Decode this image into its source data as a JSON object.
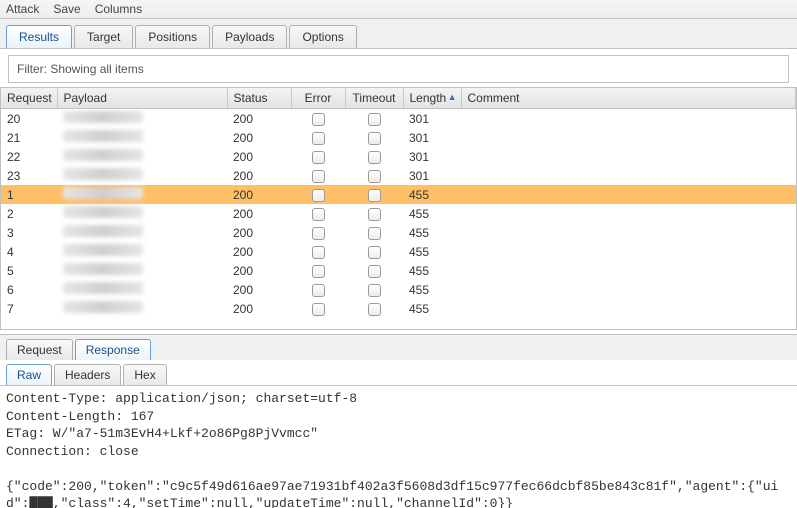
{
  "menu": {
    "attack": "Attack",
    "save": "Save",
    "columns": "Columns"
  },
  "tabs": {
    "results": "Results",
    "target": "Target",
    "positions": "Positions",
    "payloads": "Payloads",
    "options": "Options"
  },
  "filter": {
    "label": "Filter: Showing all items"
  },
  "columns": {
    "request": "Request",
    "payload": "Payload",
    "status": "Status",
    "error": "Error",
    "timeout": "Timeout",
    "length": "Length",
    "comment": "Comment"
  },
  "rows": [
    {
      "request": "20",
      "status": "200",
      "length": "301",
      "selected": false
    },
    {
      "request": "21",
      "status": "200",
      "length": "301",
      "selected": false
    },
    {
      "request": "22",
      "status": "200",
      "length": "301",
      "selected": false
    },
    {
      "request": "23",
      "status": "200",
      "length": "301",
      "selected": false
    },
    {
      "request": "1",
      "status": "200",
      "length": "455",
      "selected": true
    },
    {
      "request": "2",
      "status": "200",
      "length": "455",
      "selected": false
    },
    {
      "request": "3",
      "status": "200",
      "length": "455",
      "selected": false
    },
    {
      "request": "4",
      "status": "200",
      "length": "455",
      "selected": false
    },
    {
      "request": "5",
      "status": "200",
      "length": "455",
      "selected": false
    },
    {
      "request": "6",
      "status": "200",
      "length": "455",
      "selected": false
    },
    {
      "request": "7",
      "status": "200",
      "length": "455",
      "selected": false
    }
  ],
  "subtabs": {
    "request": "Request",
    "response": "Response"
  },
  "innertabs": {
    "raw": "Raw",
    "headers": "Headers",
    "hex": "Hex"
  },
  "raw": "Content-Type: application/json; charset=utf-8\nContent-Length: 167\nETag: W/\"a7-51m3EvH4+Lkf+2o86Pg8PjVvmcc\"\nConnection: close\n\n{\"code\":200,\"token\":\"c9c5f49d616ae97ae71931bf402a3f5608d3df15c977fec66dcbf85be843c81f\",\"agent\":{\"uid\":███,\"class\":4,\"setTime\":null,\"updateTime\":null,\"channelId\":0}}"
}
